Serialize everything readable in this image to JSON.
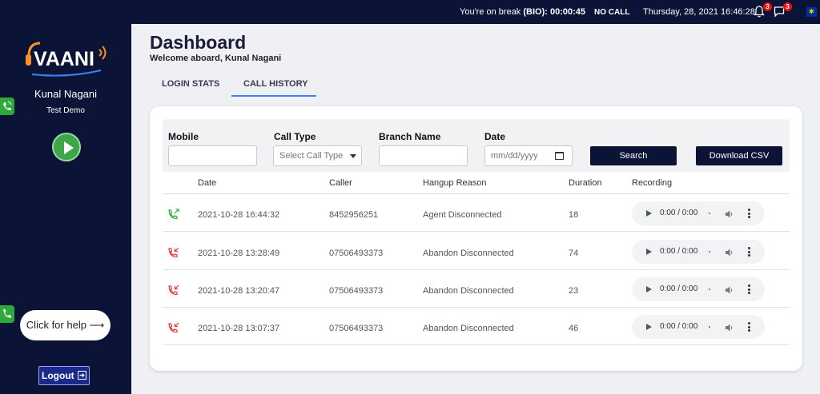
{
  "topbar": {
    "break_text": "You're on break",
    "break_code": "(BIO):",
    "break_timer": "00:00:45",
    "call_status": "NO CALL",
    "datetime": "Thursday, 28, 2021 16:46:28",
    "notification_count": "3",
    "message_count": "3"
  },
  "sidebar": {
    "logo_text": "VAANI",
    "user_name": "Kunal Nagani",
    "user_subtitle": "Test Demo",
    "help_label": "Click for help",
    "help_arrow": "⟶",
    "logout_label": "Logout"
  },
  "main": {
    "title": "Dashboard",
    "welcome": "Welcome aboard, Kunal Nagani",
    "tabs": [
      {
        "label": "LOGIN STATS",
        "active": false
      },
      {
        "label": "CALL HISTORY",
        "active": true
      }
    ]
  },
  "filters": {
    "mobile_label": "Mobile",
    "mobile_value": "",
    "call_type_label": "Call Type",
    "call_type_placeholder": "Select Call Type",
    "branch_label": "Branch Name",
    "branch_value": "",
    "date_label": "Date",
    "date_placeholder": "mm/dd/yyyy",
    "search_label": "Search",
    "download_label": "Download CSV"
  },
  "table": {
    "headers": [
      "Date",
      "Caller",
      "Hangup Reason",
      "Duration",
      "Recording"
    ],
    "rows": [
      {
        "direction": "outgoing",
        "date": "2021-10-28 16:44:32",
        "caller": "8452956251",
        "reason": "Agent Disconnected",
        "duration": "18",
        "recording": "0:00 / 0:00"
      },
      {
        "direction": "missed",
        "date": "2021-10-28 13:28:49",
        "caller": "07506493373",
        "reason": "Abandon Disconnected",
        "duration": "74",
        "recording": "0:00 / 0:00"
      },
      {
        "direction": "missed",
        "date": "2021-10-28 13:20:47",
        "caller": "07506493373",
        "reason": "Abandon Disconnected",
        "duration": "23",
        "recording": "0:00 / 0:00"
      },
      {
        "direction": "missed",
        "date": "2021-10-28 13:07:37",
        "caller": "07506493373",
        "reason": "Abandon Disconnected",
        "duration": "46",
        "recording": "0:00 / 0:00"
      }
    ]
  },
  "colors": {
    "sidebar_bg": "#0b1437",
    "accent_blue": "#3b82f6",
    "outgoing_green": "#2eaa3c",
    "missed_red": "#e53935"
  }
}
